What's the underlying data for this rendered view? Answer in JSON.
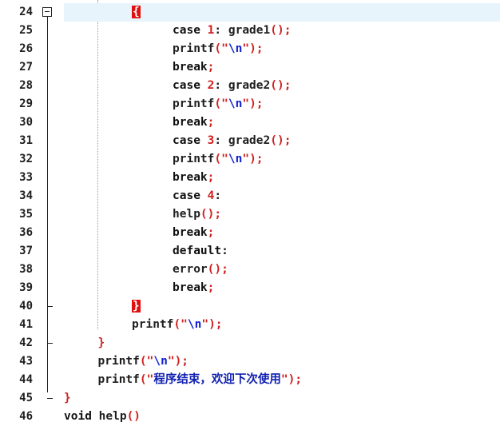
{
  "editor": {
    "lines": [
      {
        "num": "24",
        "indent": 10,
        "tokens": [
          {
            "t": "{",
            "c": "brace-match"
          }
        ],
        "highlight": true
      },
      {
        "num": "25",
        "indent": 16,
        "tokens": [
          {
            "t": "case",
            "c": "kw"
          },
          {
            "t": " "
          },
          {
            "t": "1",
            "c": "num"
          },
          {
            "t": ":",
            "c": "fn"
          },
          {
            "t": " grade1",
            "c": "fn"
          },
          {
            "t": "()",
            "c": "paren"
          },
          {
            "t": ";",
            "c": "semi"
          }
        ]
      },
      {
        "num": "26",
        "indent": 16,
        "tokens": [
          {
            "t": "printf",
            "c": "fn"
          },
          {
            "t": "(",
            "c": "paren"
          },
          {
            "t": "\"",
            "c": "str"
          },
          {
            "t": "\\n",
            "c": "esc"
          },
          {
            "t": "\"",
            "c": "str"
          },
          {
            "t": ")",
            "c": "paren"
          },
          {
            "t": ";",
            "c": "semi"
          }
        ]
      },
      {
        "num": "27",
        "indent": 16,
        "tokens": [
          {
            "t": "break",
            "c": "kw"
          },
          {
            "t": ";",
            "c": "semi"
          }
        ]
      },
      {
        "num": "28",
        "indent": 16,
        "tokens": [
          {
            "t": "case",
            "c": "kw"
          },
          {
            "t": " "
          },
          {
            "t": "2",
            "c": "num"
          },
          {
            "t": ":",
            "c": "fn"
          },
          {
            "t": " grade2",
            "c": "fn"
          },
          {
            "t": "()",
            "c": "paren"
          },
          {
            "t": ";",
            "c": "semi"
          }
        ]
      },
      {
        "num": "29",
        "indent": 16,
        "tokens": [
          {
            "t": "printf",
            "c": "fn"
          },
          {
            "t": "(",
            "c": "paren"
          },
          {
            "t": "\"",
            "c": "str"
          },
          {
            "t": "\\n",
            "c": "esc"
          },
          {
            "t": "\"",
            "c": "str"
          },
          {
            "t": ")",
            "c": "paren"
          },
          {
            "t": ";",
            "c": "semi"
          }
        ]
      },
      {
        "num": "30",
        "indent": 16,
        "tokens": [
          {
            "t": "break",
            "c": "kw"
          },
          {
            "t": ";",
            "c": "semi"
          }
        ]
      },
      {
        "num": "31",
        "indent": 16,
        "tokens": [
          {
            "t": "case",
            "c": "kw"
          },
          {
            "t": " "
          },
          {
            "t": "3",
            "c": "num"
          },
          {
            "t": ":",
            "c": "fn"
          },
          {
            "t": " grade2",
            "c": "fn"
          },
          {
            "t": "()",
            "c": "paren"
          },
          {
            "t": ";",
            "c": "semi"
          }
        ]
      },
      {
        "num": "32",
        "indent": 16,
        "tokens": [
          {
            "t": "printf",
            "c": "fn"
          },
          {
            "t": "(",
            "c": "paren"
          },
          {
            "t": "\"",
            "c": "str"
          },
          {
            "t": "\\n",
            "c": "esc"
          },
          {
            "t": "\"",
            "c": "str"
          },
          {
            "t": ")",
            "c": "paren"
          },
          {
            "t": ";",
            "c": "semi"
          }
        ]
      },
      {
        "num": "33",
        "indent": 16,
        "tokens": [
          {
            "t": "break",
            "c": "kw"
          },
          {
            "t": ";",
            "c": "semi"
          }
        ]
      },
      {
        "num": "34",
        "indent": 16,
        "tokens": [
          {
            "t": "case",
            "c": "kw"
          },
          {
            "t": " "
          },
          {
            "t": "4",
            "c": "num"
          },
          {
            "t": ":",
            "c": "fn"
          }
        ]
      },
      {
        "num": "35",
        "indent": 16,
        "tokens": [
          {
            "t": "help",
            "c": "fn"
          },
          {
            "t": "()",
            "c": "paren"
          },
          {
            "t": ";",
            "c": "semi"
          }
        ]
      },
      {
        "num": "36",
        "indent": 16,
        "tokens": [
          {
            "t": "break",
            "c": "kw"
          },
          {
            "t": ";",
            "c": "semi"
          }
        ]
      },
      {
        "num": "37",
        "indent": 16,
        "tokens": [
          {
            "t": "default",
            "c": "kw"
          },
          {
            "t": ":",
            "c": "fn"
          }
        ]
      },
      {
        "num": "38",
        "indent": 16,
        "tokens": [
          {
            "t": "error",
            "c": "fn"
          },
          {
            "t": "()",
            "c": "paren"
          },
          {
            "t": ";",
            "c": "semi"
          }
        ]
      },
      {
        "num": "39",
        "indent": 16,
        "tokens": [
          {
            "t": "break",
            "c": "kw"
          },
          {
            "t": ";",
            "c": "semi"
          }
        ]
      },
      {
        "num": "40",
        "indent": 10,
        "tokens": [
          {
            "t": "}",
            "c": "brace-match"
          }
        ]
      },
      {
        "num": "41",
        "indent": 10,
        "tokens": [
          {
            "t": "printf",
            "c": "fn"
          },
          {
            "t": "(",
            "c": "paren"
          },
          {
            "t": "\"",
            "c": "str"
          },
          {
            "t": "\\n",
            "c": "esc"
          },
          {
            "t": "\"",
            "c": "str"
          },
          {
            "t": ")",
            "c": "paren"
          },
          {
            "t": ";",
            "c": "semi"
          }
        ]
      },
      {
        "num": "42",
        "indent": 5,
        "tokens": [
          {
            "t": "}",
            "c": "brace"
          }
        ]
      },
      {
        "num": "43",
        "indent": 5,
        "tokens": [
          {
            "t": "printf",
            "c": "fn"
          },
          {
            "t": "(",
            "c": "paren"
          },
          {
            "t": "\"",
            "c": "str"
          },
          {
            "t": "\\n",
            "c": "esc"
          },
          {
            "t": "\"",
            "c": "str"
          },
          {
            "t": ")",
            "c": "paren"
          },
          {
            "t": ";",
            "c": "semi"
          }
        ]
      },
      {
        "num": "44",
        "indent": 5,
        "tokens": [
          {
            "t": "printf",
            "c": "fn"
          },
          {
            "t": "(",
            "c": "paren"
          },
          {
            "t": "\"",
            "c": "str"
          },
          {
            "t": "程序结束，欢迎下次使用",
            "c": "cn"
          },
          {
            "t": "\"",
            "c": "str"
          },
          {
            "t": ")",
            "c": "paren"
          },
          {
            "t": ";",
            "c": "semi"
          }
        ]
      },
      {
        "num": "45",
        "indent": 0,
        "tokens": [
          {
            "t": "}",
            "c": "brace"
          }
        ]
      },
      {
        "num": "46",
        "indent": 0,
        "tokens": [
          {
            "t": "void",
            "c": "kw"
          },
          {
            "t": " help",
            "c": "fn"
          },
          {
            "t": "()",
            "c": "paren"
          }
        ]
      }
    ]
  }
}
